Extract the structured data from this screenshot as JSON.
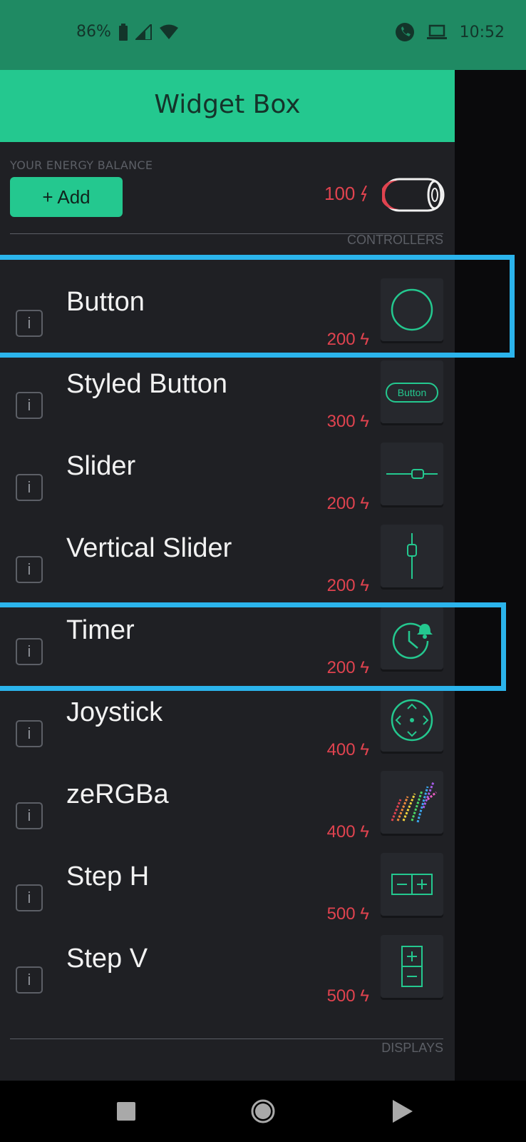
{
  "statusbar": {
    "battery_pct": "86%",
    "time": "10:52"
  },
  "header": {
    "title": "Widget Box"
  },
  "energy": {
    "label": "YOUR ENERGY BALANCE",
    "add_label": "+ Add",
    "balance": "100"
  },
  "sections": {
    "controllers": "CONTROLLERS",
    "displays": "DISPLAYS"
  },
  "widgets": [
    {
      "name": "Button",
      "cost": "200",
      "icon": "circle-button-icon"
    },
    {
      "name": "Styled Button",
      "cost": "300",
      "icon": "styled-button-icon",
      "icon_text": "Button"
    },
    {
      "name": "Slider",
      "cost": "200",
      "icon": "slider-icon"
    },
    {
      "name": "Vertical Slider",
      "cost": "200",
      "icon": "vertical-slider-icon"
    },
    {
      "name": "Timer",
      "cost": "200",
      "icon": "timer-icon"
    },
    {
      "name": "Joystick",
      "cost": "400",
      "icon": "joystick-icon"
    },
    {
      "name": "zeRGBa",
      "cost": "400",
      "icon": "zergba-icon"
    },
    {
      "name": "Step H",
      "cost": "500",
      "icon": "step-h-icon"
    },
    {
      "name": "Step V",
      "cost": "500",
      "icon": "step-v-icon"
    }
  ],
  "colors": {
    "accent": "#24c88f",
    "cost": "#e0434f",
    "highlight": "#2bb4ec",
    "panel": "#1f2024"
  }
}
